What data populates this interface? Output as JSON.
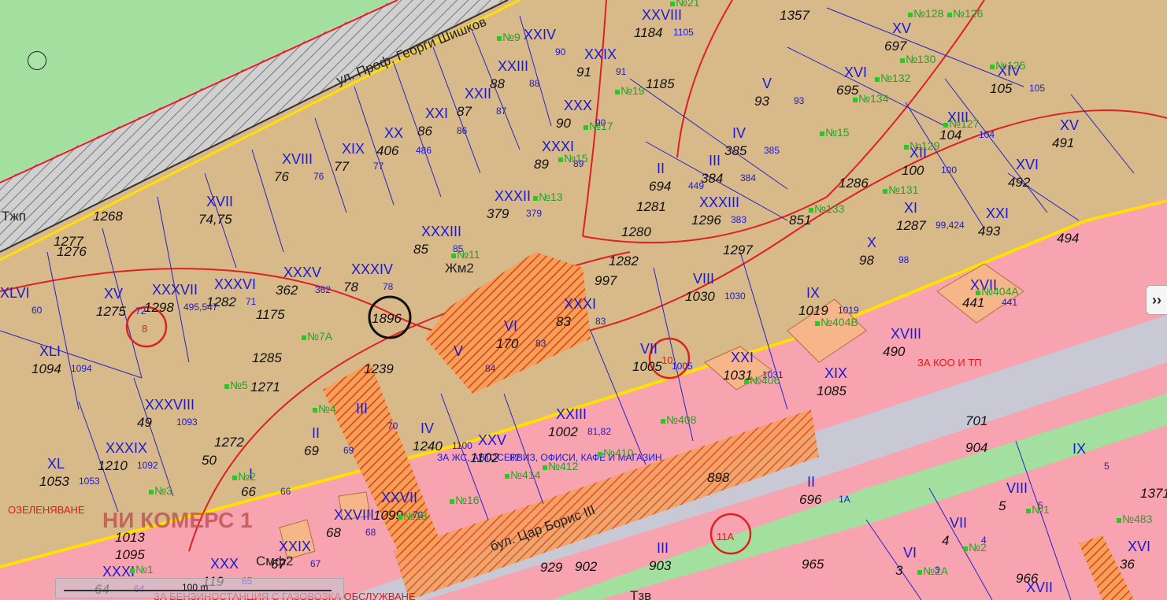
{
  "street_labels": {
    "road_north": "ул. Проф. Георги Шишков",
    "boulevard": "бул. Цар Борис III"
  },
  "zone_codes": [
    "Жм2",
    "Смф2",
    "Тжп",
    "Тзв"
  ],
  "circle_labels": [
    "1896",
    "8",
    "10",
    "11А"
  ],
  "zone_text": {
    "commerce": "НИ КОМЕРС 1",
    "service_zone": "ЗА ЖС, АВТОСЕРВИЗ, ОФИСИ, КАФЕ И МАГАЗИН",
    "greening": "ОЗЕЛЕНЯВАНЕ",
    "koo": "ЗА КОО И ТП",
    "gas_station": "ЗА БЕНЗИНОСТАНЦИЯ С ГАЗОВОЗКА ОБСЛУЖВАНЕ"
  },
  "parcels": [
    {
      "roman": "XXVIII",
      "num": "1184",
      "lot": "1105"
    },
    {
      "roman": "XXIV",
      "num": "",
      "lot": "90"
    },
    {
      "roman": "XXIII",
      "num": "88",
      "lot": "88"
    },
    {
      "roman": "XXII",
      "num": "87",
      "lot": "87"
    },
    {
      "roman": "XXI",
      "num": "86",
      "lot": "86"
    },
    {
      "roman": "XX",
      "num": "406",
      "lot": "486"
    },
    {
      "roman": "XIX",
      "num": "77",
      "lot": "77"
    },
    {
      "roman": "XVIII",
      "num": "76",
      "lot": "76"
    },
    {
      "roman": "XVII",
      "num": "74,75",
      "lot": ""
    },
    {
      "roman": "XXIX",
      "num": "91",
      "lot": "91"
    },
    {
      "roman": "XXX",
      "num": "90",
      "lot": "90"
    },
    {
      "roman": "XXXI",
      "num": "89",
      "lot": "89"
    },
    {
      "roman": "XXXII",
      "num": "379",
      "lot": "379"
    },
    {
      "roman": "XXXIII",
      "num": "85",
      "lot": "85"
    },
    {
      "roman": "XXXIV",
      "num": "78",
      "lot": "78"
    },
    {
      "roman": "XXXV",
      "num": "362",
      "lot": "362"
    },
    {
      "roman": "XXXVI",
      "num": "1282",
      "lot": "71"
    },
    {
      "roman": "XXXVII",
      "num": "1298",
      "lot": "495,547"
    },
    {
      "roman": "XV",
      "num": "1275",
      "lot": "72"
    },
    {
      "roman": "XLVI",
      "num": "",
      "lot": "60"
    },
    {
      "roman": "XLI",
      "num": "1094",
      "lot": "1094"
    },
    {
      "roman": "XXXVIII",
      "num": "49",
      "lot": "1093"
    },
    {
      "roman": "XXXIX",
      "num": "1210",
      "lot": "1092"
    },
    {
      "roman": "XL",
      "num": "1053",
      "lot": "1053"
    },
    {
      "roman": "V",
      "num": "93",
      "lot": "93"
    },
    {
      "roman": "IV",
      "num": "385",
      "lot": "385"
    },
    {
      "roman": "III",
      "num": "384",
      "lot": "384"
    },
    {
      "roman": "II",
      "num": "694",
      "lot": "449"
    },
    {
      "roman": "XXXIII",
      "num": "1296",
      "lot": "383"
    },
    {
      "roman": "XV",
      "num": "697",
      "lot": ""
    },
    {
      "roman": "XVI",
      "num": "695",
      "lot": ""
    },
    {
      "roman": "XIV",
      "num": "105",
      "lot": "105"
    },
    {
      "roman": "XIII",
      "num": "104",
      "lot": "104"
    },
    {
      "roman": "XII",
      "num": "100",
      "lot": "100"
    },
    {
      "roman": "XI",
      "num": "1287",
      "lot": "99,424"
    },
    {
      "roman": "X",
      "num": "98",
      "lot": "98"
    },
    {
      "roman": "XV",
      "num": "491",
      "lot": ""
    },
    {
      "roman": "XVI",
      "num": "492",
      "lot": ""
    },
    {
      "roman": "XXI",
      "num": "493",
      "lot": ""
    },
    {
      "roman": "VIII",
      "num": "1030",
      "lot": "1030"
    },
    {
      "roman": "IX",
      "num": "1019",
      "lot": "1019"
    },
    {
      "roman": "XVII",
      "num": "441",
      "lot": "441"
    },
    {
      "roman": "XVIII",
      "num": "490",
      "lot": ""
    },
    {
      "roman": "XIX",
      "num": "1085",
      "lot": ""
    },
    {
      "roman": "XXI",
      "num": "1031",
      "lot": "1031"
    },
    {
      "roman": "VII",
      "num": "1005",
      "lot": "1005"
    },
    {
      "roman": "XXXI",
      "num": "83",
      "lot": "83"
    },
    {
      "roman": "VI",
      "num": "170",
      "lot": "83"
    },
    {
      "roman": "V",
      "num": "",
      "lot": "84"
    },
    {
      "roman": "III",
      "num": "",
      "lot": "70"
    },
    {
      "roman": "II",
      "num": "69",
      "lot": "69"
    },
    {
      "roman": "I",
      "num": "66",
      "lot": "66"
    },
    {
      "roman": "IV",
      "num": "1240",
      "lot": "1100"
    },
    {
      "roman": "XXV",
      "num": "1102",
      "lot": "82"
    },
    {
      "roman": "XXIII",
      "num": "1002",
      "lot": "81,82"
    },
    {
      "roman": "XXVII",
      "num": "1099",
      "lot": "70"
    },
    {
      "roman": "XXVIII",
      "num": "68",
      "lot": "68"
    },
    {
      "roman": "XXIX",
      "num": "67",
      "lot": "67"
    },
    {
      "roman": "XXX",
      "num": "119",
      "lot": "65"
    },
    {
      "roman": "XXXI",
      "num": "64",
      "lot": "64"
    },
    {
      "roman": "II",
      "num": "696",
      "lot": "1А"
    },
    {
      "roman": "III",
      "num": "903",
      "lot": ""
    },
    {
      "roman": "IX",
      "num": "",
      "lot": "5"
    },
    {
      "roman": "VIII",
      "num": "5",
      "lot": "5"
    },
    {
      "roman": "VII",
      "num": "4",
      "lot": "4"
    },
    {
      "roman": "VI",
      "num": "3",
      "lot": "3"
    },
    {
      "roman": "XVI",
      "num": "36",
      "lot": ""
    },
    {
      "roman": "XVII",
      "num": "",
      "lot": ""
    }
  ],
  "loose_numbers": [
    "1357",
    "1185",
    "1268",
    "1277",
    "1276",
    "1175",
    "1285",
    "1271",
    "1272",
    "50",
    "1013",
    "1095",
    "1239",
    "997",
    "1282",
    "1297",
    "851",
    "1286",
    "1280",
    "1281",
    "701",
    "904",
    "965",
    "929",
    "902",
    "966",
    "1371",
    "494",
    "898"
  ],
  "house_numbers": [
    "№21",
    "№9",
    "№19",
    "№17",
    "№15",
    "№13",
    "№11",
    "№7А",
    "№5",
    "№4",
    "№3",
    "№2",
    "№1",
    "№18",
    "№16",
    "№414",
    "№412",
    "№410",
    "№408",
    "№406",
    "№404В",
    "№404А",
    "№15",
    "№133",
    "№131",
    "№129",
    "№127",
    "№134",
    "№132",
    "№130",
    "№128",
    "№126",
    "№125",
    "№2А",
    "№2",
    "№1",
    "№483"
  ],
  "scale": {
    "label": "100 m"
  },
  "controls": {
    "expand": "››"
  }
}
